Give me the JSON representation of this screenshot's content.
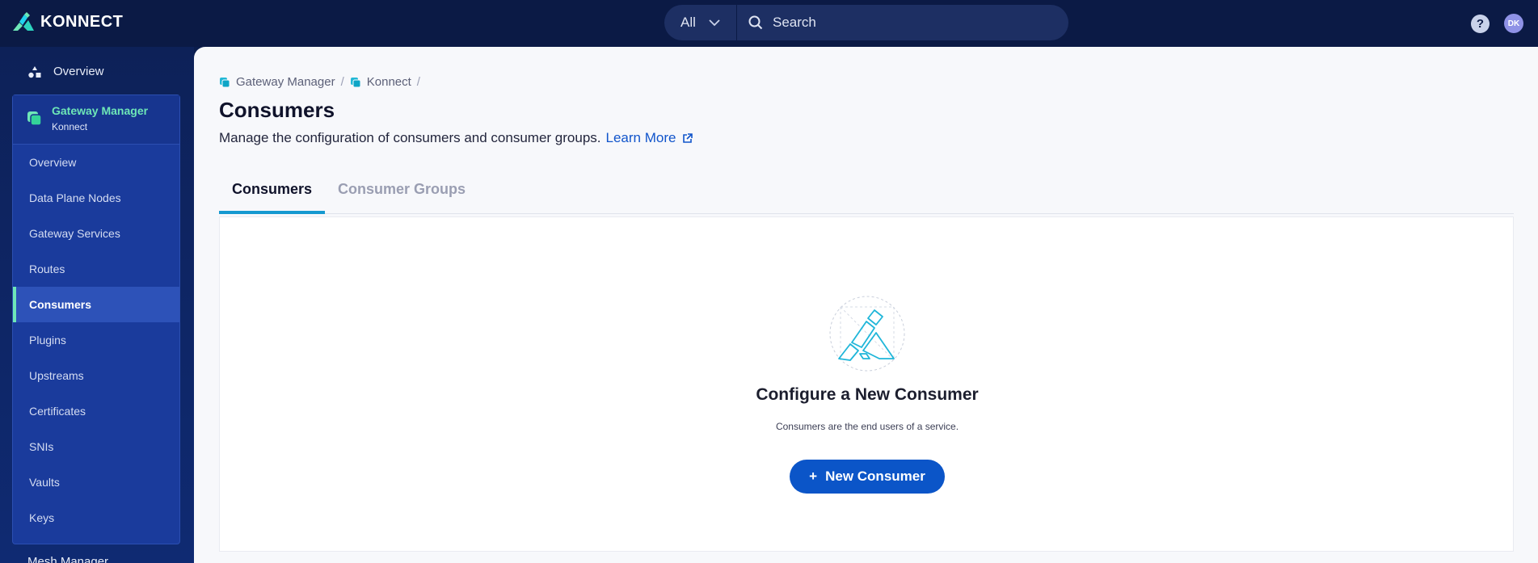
{
  "brand": {
    "name": "KONNECT",
    "accent": "#6ee7b7",
    "primary": "#0b55c8"
  },
  "topbar": {
    "scope": "All",
    "search_placeholder": "Search",
    "help_label": "?",
    "avatar_initials": "DK"
  },
  "sidebar": {
    "top_item": "Overview",
    "gateway_manager": {
      "title": "Gateway Manager",
      "subtitle": "Konnect"
    },
    "items": [
      {
        "label": "Overview",
        "active": false
      },
      {
        "label": "Data Plane Nodes",
        "active": false
      },
      {
        "label": "Gateway Services",
        "active": false
      },
      {
        "label": "Routes",
        "active": false
      },
      {
        "label": "Consumers",
        "active": true
      },
      {
        "label": "Plugins",
        "active": false
      },
      {
        "label": "Upstreams",
        "active": false
      },
      {
        "label": "Certificates",
        "active": false
      },
      {
        "label": "SNIs",
        "active": false
      },
      {
        "label": "Vaults",
        "active": false
      },
      {
        "label": "Keys",
        "active": false
      }
    ],
    "bottom_item": "Mesh Manager"
  },
  "main": {
    "breadcrumb": [
      {
        "label": "Gateway Manager"
      },
      {
        "label": "Konnect"
      }
    ],
    "separator": "/",
    "title": "Consumers",
    "description": "Manage the configuration of consumers and consumer groups.",
    "learn_more": "Learn More",
    "tabs": [
      {
        "label": "Consumers",
        "active": true
      },
      {
        "label": "Consumer Groups",
        "active": false
      }
    ],
    "empty_state": {
      "title": "Configure a New Consumer",
      "description": "Consumers are the end users of a service.",
      "button_label": "New Consumer",
      "button_icon": "+"
    }
  }
}
